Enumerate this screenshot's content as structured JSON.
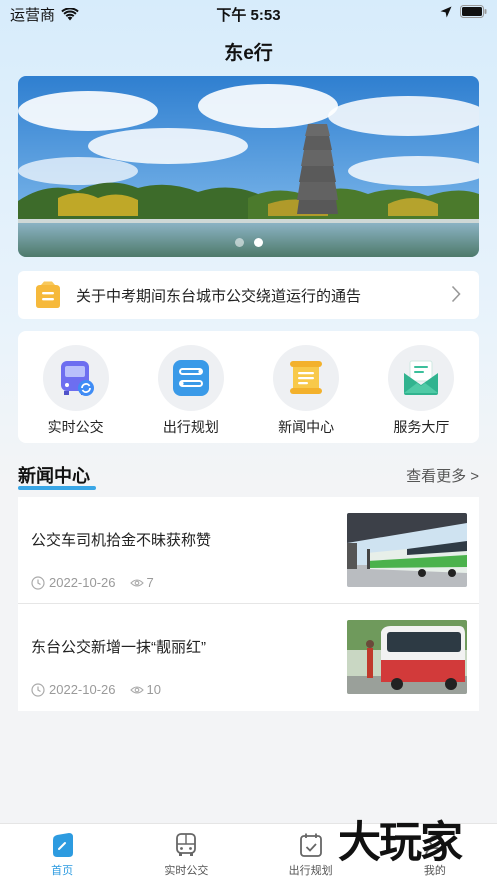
{
  "status_bar": {
    "carrier": "运营商",
    "time": "下午 5:53"
  },
  "header": {
    "title": "东e行"
  },
  "banner": {
    "active_slide": 2,
    "slide_count": 2
  },
  "notice": {
    "text": "关于中考期间东台城市公交绕道运行的通告"
  },
  "quick_menu": [
    {
      "label": "实时公交",
      "icon": "bus-icon"
    },
    {
      "label": "出行规划",
      "icon": "route-icon"
    },
    {
      "label": "新闻中心",
      "icon": "scroll-icon"
    },
    {
      "label": "服务大厅",
      "icon": "envelope-icon"
    }
  ],
  "news_section": {
    "title": "新闻中心",
    "more": "查看更多 >"
  },
  "news": [
    {
      "title": "公交车司机拾金不昧获称赞",
      "date": "2022-10-26",
      "views": "7"
    },
    {
      "title": "东台公交新增一抹“靓丽红”",
      "date": "2022-10-26",
      "views": "10"
    }
  ],
  "tabbar": [
    {
      "label": "首页",
      "icon": "home-icon",
      "active": true
    },
    {
      "label": "实时公交",
      "icon": "bus-icon",
      "active": false
    },
    {
      "label": "出行规划",
      "icon": "calendar-icon",
      "active": false
    },
    {
      "label": "我的",
      "icon": "user-icon",
      "active": false
    }
  ],
  "watermark": {
    "text": "大玩家"
  },
  "colors": {
    "accent": "#2d9be0",
    "underline": "#3aa6e6",
    "notice_icon": "#f6b93b"
  }
}
